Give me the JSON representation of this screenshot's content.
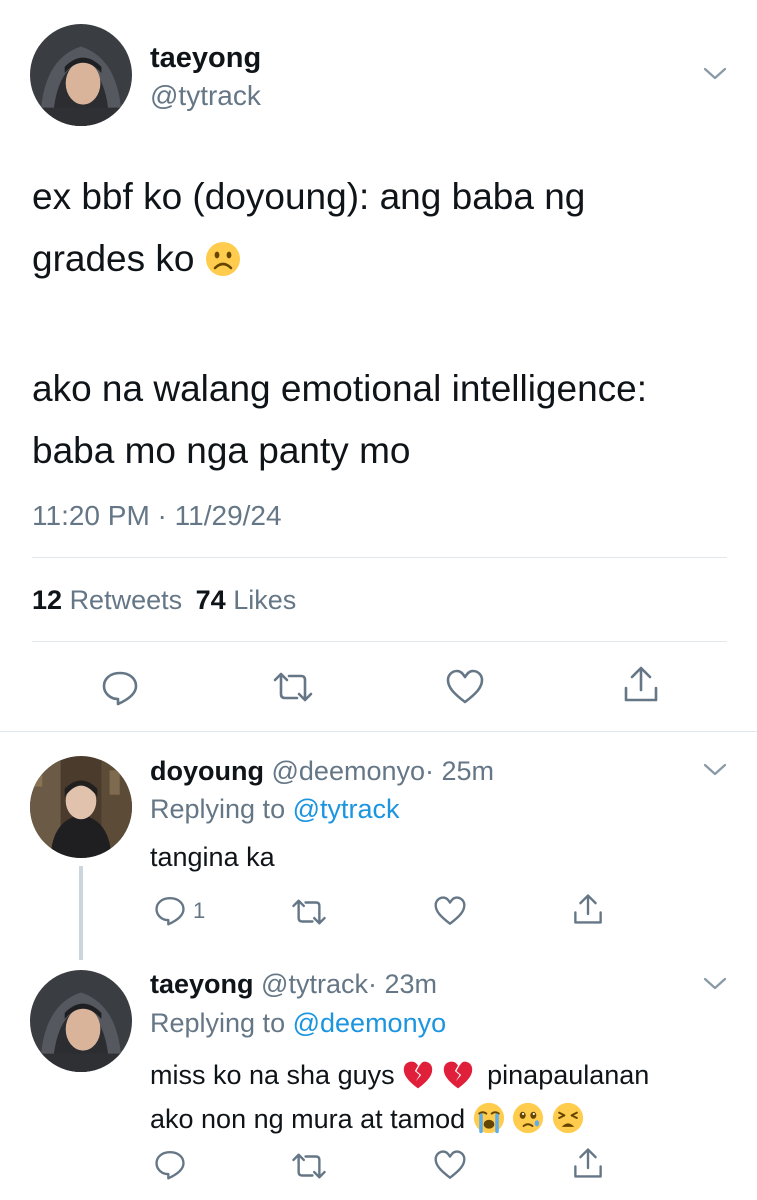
{
  "main_tweet": {
    "author_name": "taeyong",
    "author_handle": "@tytrack",
    "text_line1": "ex bbf ko (doyoung): ang baba ng",
    "text_line2": "grades ko",
    "text_line3": "ako na walang emotional intelligence:",
    "text_line4": "baba mo nga panty mo",
    "timestamp": "11:20 PM · 11/29/24",
    "retweets_count": "12",
    "retweets_label": "Retweets",
    "likes_count": "74",
    "likes_label": "Likes",
    "emoji": "frowning-face"
  },
  "replies": [
    {
      "author_name": "doyoung",
      "author_handle": "@deemonyo",
      "time": "· 25m",
      "replying_prefix": "Replying to",
      "replying_to": "@tytrack",
      "text": "tangina ka",
      "reply_count": "1"
    },
    {
      "author_name": "taeyong",
      "author_handle": "@tytrack",
      "time": "· 23m",
      "replying_prefix": "Replying to",
      "replying_to": "@deemonyo",
      "text_line1a": "miss ko na sha guys",
      "text_line1b": "pinapaulanan",
      "text_line2": "ako non ng mura at tamod",
      "emojis": [
        "broken-heart",
        "broken-heart",
        "loudly-crying-face",
        "face-holding-back-tears",
        "weary-face"
      ]
    }
  ],
  "colors": {
    "text": "#0f1419",
    "muted": "#657786",
    "link": "#1b95e0",
    "divider": "#e1e8ed",
    "broken_heart": "#e0203a",
    "emoji_yellow": "#ffcc4d"
  }
}
